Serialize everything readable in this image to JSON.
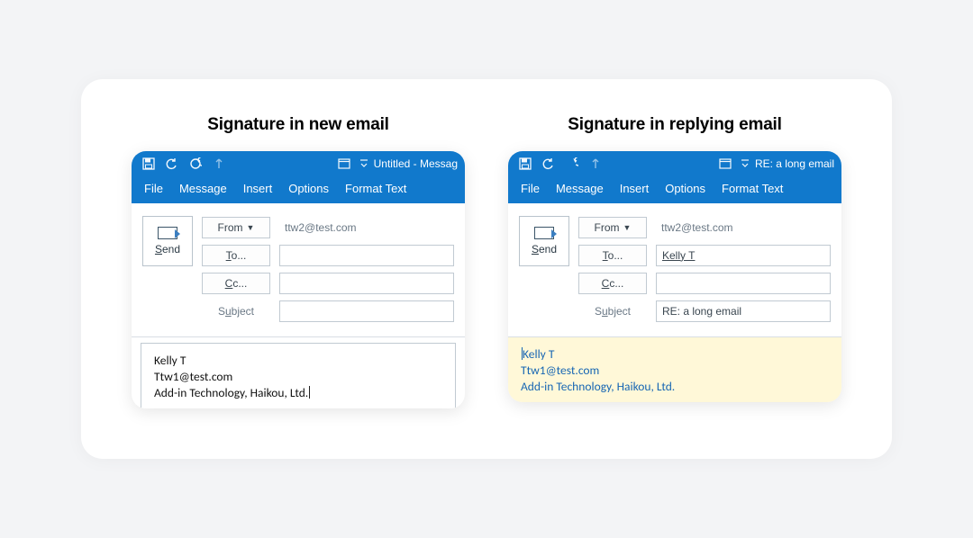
{
  "captions": {
    "new": "Signature in new email",
    "reply": "Signature in replying email"
  },
  "ribbon": {
    "tabs": [
      "File",
      "Message",
      "Insert",
      "Options",
      "Format Text"
    ]
  },
  "newEmail": {
    "title": "Untitled  -  Messag",
    "from_label": "From",
    "to_label": "To...",
    "cc_label": "Cc...",
    "subject_label": "Subject",
    "from_value": "ttw2@test.com",
    "to_value": "",
    "cc_value": "",
    "subject_value": "",
    "send_label": "Send",
    "signature": {
      "line1": "Kelly T",
      "line2": "Ttw1@test.com",
      "line3": "Add-in Technology, Haikou, Ltd."
    }
  },
  "replyEmail": {
    "title": "RE: a long email",
    "from_label": "From",
    "to_label": "To...",
    "cc_label": "Cc...",
    "subject_label": "Subject",
    "from_value": "ttw2@test.com",
    "to_value": "Kelly T",
    "cc_value": "",
    "subject_value": "RE: a long email",
    "send_label": "Send",
    "signature": {
      "line1": "Kelly T",
      "line2": "Ttw1@test.com",
      "line3": "Add-in Technology, Haikou, Ltd."
    }
  }
}
